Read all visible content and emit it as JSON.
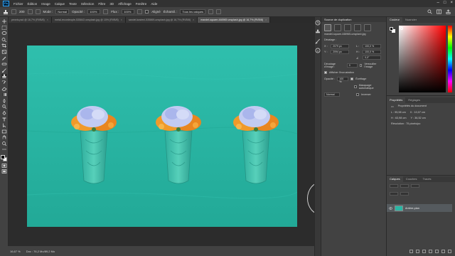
{
  "menu": {
    "logo": "Ps",
    "items": [
      "Fichier",
      "Édition",
      "Image",
      "Calque",
      "Texte",
      "Sélection",
      "Filtre",
      "3D",
      "Affichage",
      "Fenêtre",
      "Aide"
    ]
  },
  "options": {
    "mode_label": "Mode :",
    "mode_value": "Normal",
    "opacity_label": "Opacité :",
    "opacity_value": "100%",
    "flux_label": "Flux :",
    "flux_value": "100%",
    "aligne_label": "Aligné",
    "sample_label": "Échantil. :",
    "sample_value": "Tous les calques",
    "size_value": "200"
  },
  "tabs": [
    {
      "label": "pexels.psd @ 16,7% (RVB/8)",
      "active": false
    },
    {
      "label": "metal-recordeople-535843 unsplash.jpg @ 15% (RVB/8)",
      "active": false
    },
    {
      "label": "sandel-kostenl-535869-unsplash.jpg @ 16,7% (RVB/8)",
      "active": false
    },
    {
      "label": "mandel-square-446965 unsplash.jpg @ 16,7% (RVB/8)",
      "active": true
    }
  ],
  "status": {
    "zoom": "16,67 %",
    "doc": "Doc : 76,2 Mo/89,2 Mo"
  },
  "clone_source": {
    "title": "Source de duplication",
    "source_file": "mandel-square-446965-unsplash.jpg",
    "offset_label": "Décalage :",
    "x_label": "X :",
    "x_value": "2079 px",
    "y_label": "Y :",
    "y_value": "2094 px",
    "w_label": "L :",
    "w_value": "100,0 %",
    "h_label": "H :",
    "h_value": "100,0 %",
    "angle_value": "0,0°",
    "frame_label": "Décalage d'image :",
    "frame_value": "0",
    "lock_label": "Verrouiller l'image",
    "show_overlay": "Afficher l'incrustation",
    "opacity_label": "Opacité :",
    "opacity_value": "100 %",
    "clipped": "Écrêtage",
    "auto_hide": "Masquage automatique",
    "inverse": "Inverser",
    "blend": "Normal"
  },
  "color_panel": {
    "tabs": [
      "Couleur",
      "Nuancier"
    ]
  },
  "properties": {
    "tabs": [
      "Propriétés",
      "Réglages"
    ],
    "doc_props": "Propriétés du document",
    "w_label": "L : 95,98 cm",
    "x_label": "X : 10,07 cm",
    "h_label": "H : 63,98 cm",
    "y_label": "Y : 36,52 cm",
    "resolution": "Résolution : 75 pixels/po"
  },
  "layers": {
    "tabs": [
      "Calques",
      "Couches",
      "Tracés"
    ],
    "layer_name": "Arrière-plan"
  },
  "colors": {
    "wall": "#2ab6a4",
    "flower_blue": "#b9c4ef",
    "flower_orange": "#f09a2a",
    "vase": "#45c6b0"
  }
}
